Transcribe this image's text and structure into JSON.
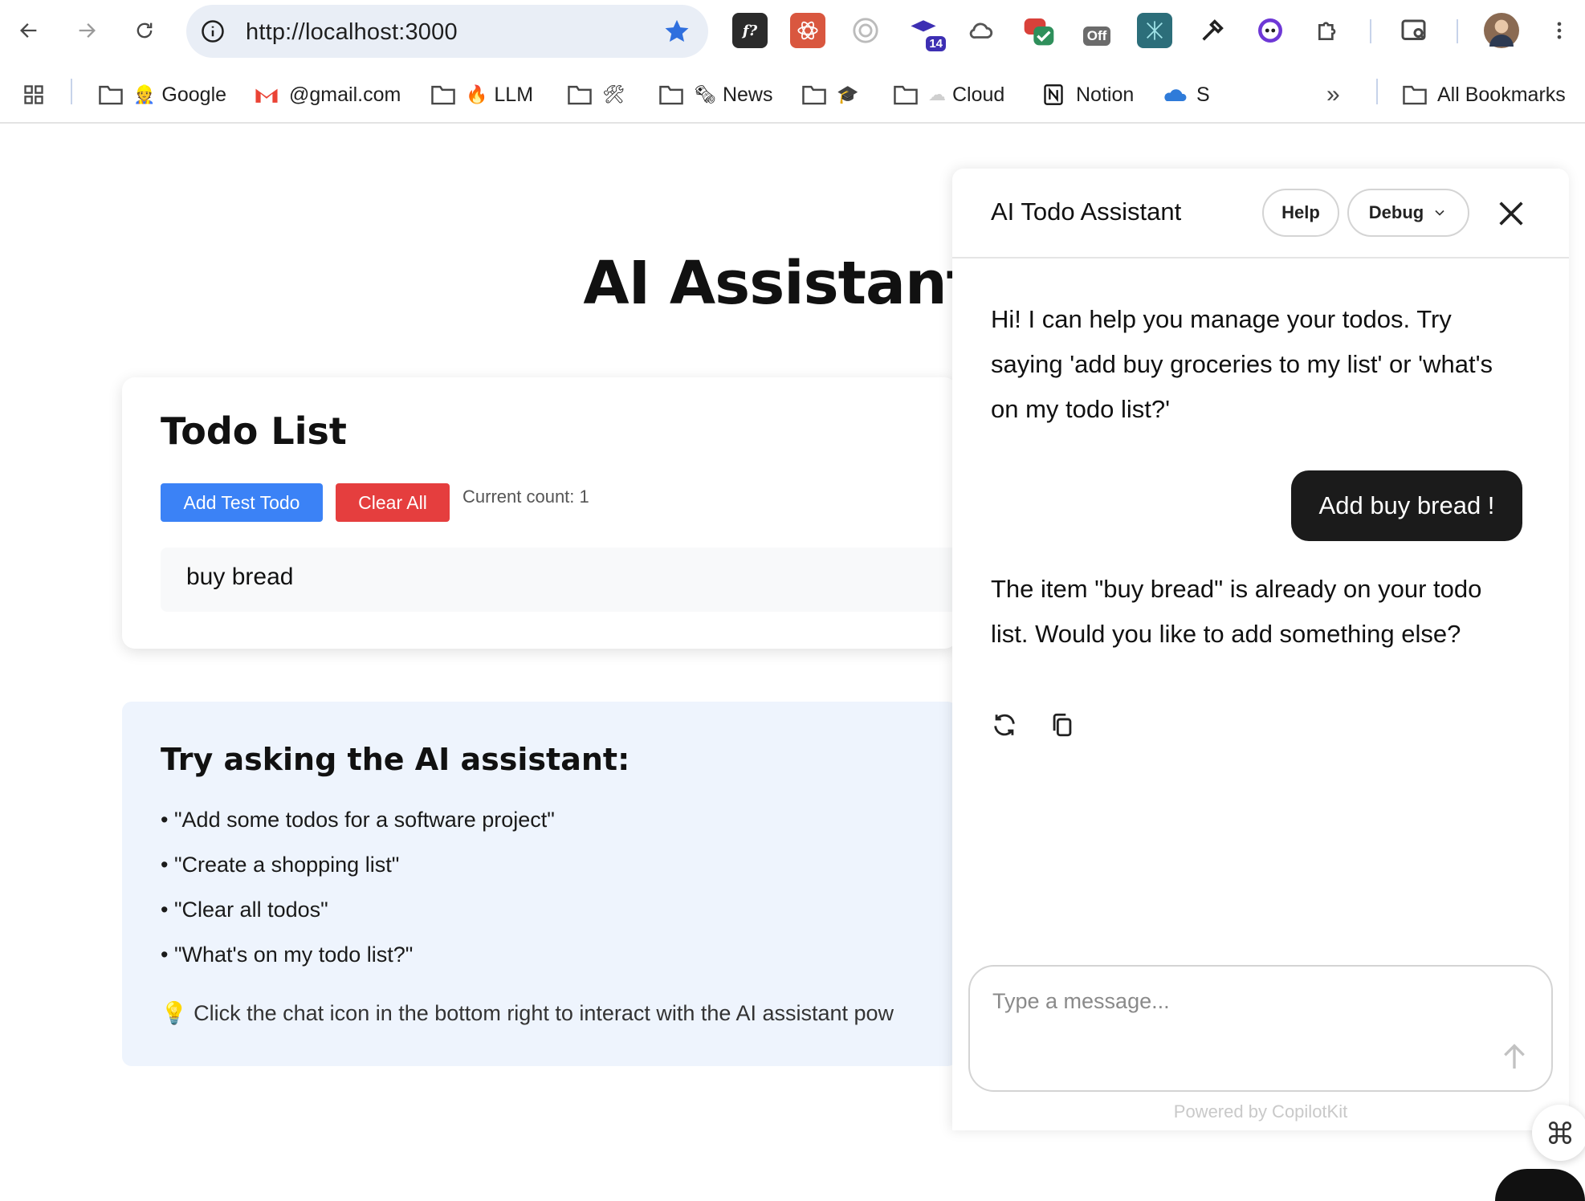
{
  "browser": {
    "url": "http://localhost:3000",
    "extensions": [
      {
        "name": "f-icon",
        "label": "f?",
        "color": "#2b2b2b"
      },
      {
        "name": "react-icon",
        "label": "",
        "color": "#d9573f"
      },
      {
        "name": "target-icon",
        "label": "",
        "color": "#ffffff"
      },
      {
        "name": "graduation-icon",
        "label": "14",
        "color": "#3d2fb3"
      },
      {
        "name": "cloud-icon",
        "label": "",
        "color": "#ffffff"
      },
      {
        "name": "check-icon",
        "label": "",
        "color": "#2f8f5b"
      },
      {
        "name": "off-icon",
        "label": "Off",
        "color": "#6b6b6b"
      },
      {
        "name": "network-icon",
        "label": "",
        "color": "#2c6e7a"
      },
      {
        "name": "dropper-icon",
        "label": "",
        "color": "#222222"
      },
      {
        "name": "eyes-icon",
        "label": "",
        "color": "#6e38d6"
      },
      {
        "name": "puzzle-icon",
        "label": "",
        "color": "#ffffff"
      }
    ]
  },
  "bookmarks": {
    "items": [
      {
        "icon": "folder-icon",
        "emoji": "👷",
        "label": "Google"
      },
      {
        "icon": "gmail-icon",
        "emoji": "",
        "label": "@gmail.com"
      },
      {
        "icon": "folder-icon",
        "emoji": "🔥",
        "label": "LLM"
      },
      {
        "icon": "folder-icon",
        "emoji": "🛠",
        "label": ""
      },
      {
        "icon": "folder-icon",
        "emoji": "🗞",
        "label": "News"
      },
      {
        "icon": "folder-icon",
        "emoji": "🎓",
        "label": ""
      },
      {
        "icon": "folder-icon",
        "emoji": "☁",
        "label": "Cloud"
      },
      {
        "icon": "notion-icon",
        "emoji": "",
        "label": "Notion"
      },
      {
        "icon": "onedrive-icon",
        "emoji": "",
        "label": "S"
      }
    ],
    "overflow": "»",
    "all_bookmarks": "All Bookmarks"
  },
  "page": {
    "title": "AI Assistant with C",
    "todo_card": {
      "heading": "Todo List",
      "add_button": "Add Test Todo",
      "clear_button": "Clear All",
      "count_text": "Current count: 1",
      "items": [
        "buy bread"
      ]
    },
    "tips": {
      "heading": "Try asking the AI assistant:",
      "items": [
        "• \"Add some todos for a software project\"",
        "• \"Create a shopping list\"",
        "• \"Clear all todos\"",
        "• \"What's on my todo list?\""
      ],
      "hint": "💡 Click the chat icon in the bottom right to interact with the AI assistant pow"
    }
  },
  "chat": {
    "title": "AI Todo Assistant",
    "help_button": "Help",
    "debug_button": "Debug",
    "messages": {
      "assistant_1": "Hi! I can help you manage your todos. Try saying 'add buy groceries to my list' or 'what's on my todo list?'",
      "user_1": "Add buy bread !",
      "assistant_2": "The item \"buy bread\" is already on your todo list. Would you like to add something else?"
    },
    "input_placeholder": "Type a message...",
    "powered_by": "Powered by CopilotKit"
  }
}
